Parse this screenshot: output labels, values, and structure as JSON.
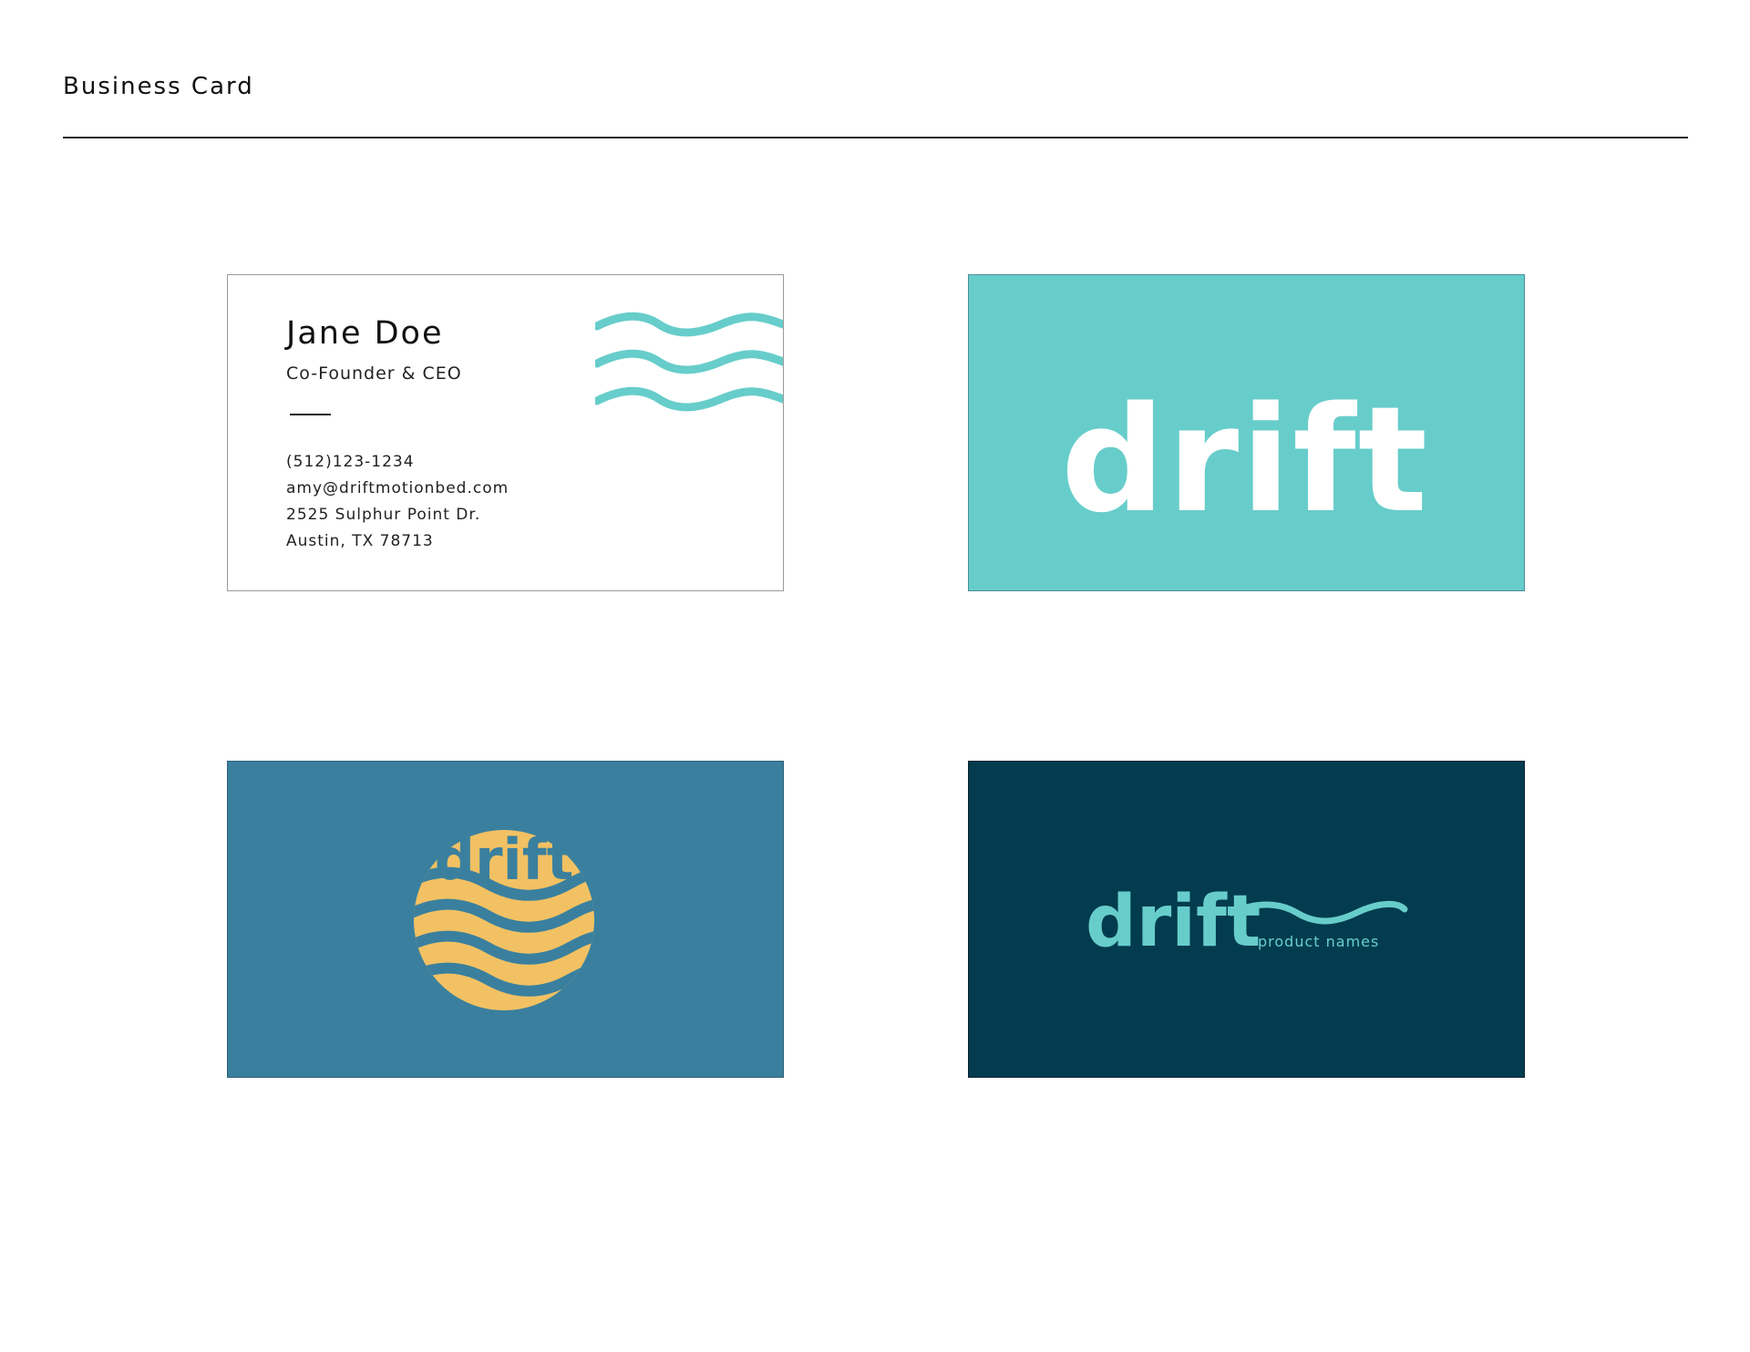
{
  "page": {
    "title": "Business Card"
  },
  "card_front": {
    "name": "Jane Doe",
    "job_title": "Co-Founder & CEO",
    "phone": "(512)123-1234",
    "email": "amy@driftmotionbed.com",
    "address_line1": "2525 Sulphur Point Dr.",
    "address_line2": "Austin, TX 78713"
  },
  "logo_card": {
    "wordmark": "drift"
  },
  "badge_card": {
    "wordmark": "drift"
  },
  "product_card": {
    "wordmark": "drift",
    "tagline": "product names"
  },
  "colors": {
    "teal": "#67cdcb",
    "blue": "#3a809e",
    "navy": "#033c4f",
    "yellow": "#f2c163",
    "white": "#ffffff"
  }
}
